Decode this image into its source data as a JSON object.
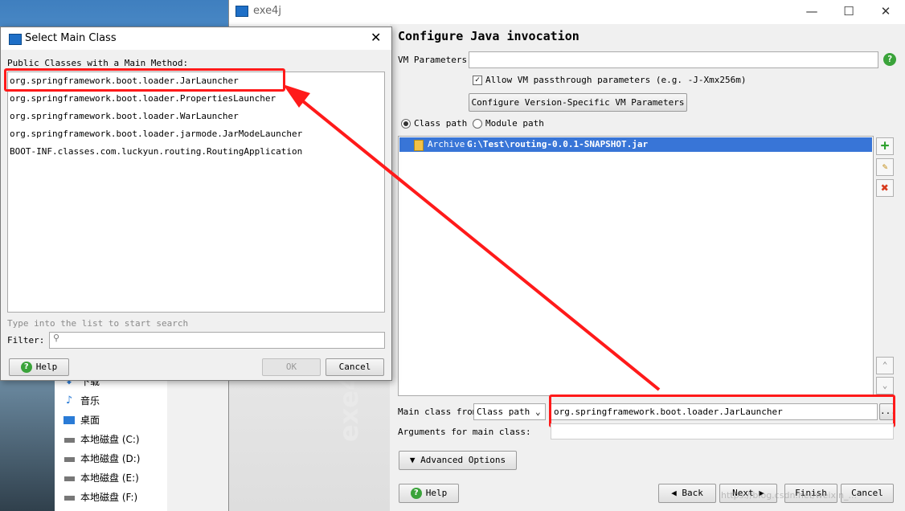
{
  "desktop": {
    "explorer_items": [
      {
        "label": "下载",
        "icon": "download-arrow-icon"
      },
      {
        "label": "音乐",
        "icon": "music-note-icon"
      },
      {
        "label": "桌面",
        "icon": "desktop-icon"
      },
      {
        "label": "本地磁盘 (C:)",
        "icon": "drive-icon"
      },
      {
        "label": "本地磁盘 (D:)",
        "icon": "drive-icon"
      },
      {
        "label": "本地磁盘 (E:)",
        "icon": "drive-icon"
      },
      {
        "label": "本地磁盘 (F:)",
        "icon": "drive-icon"
      }
    ]
  },
  "main_window": {
    "title": "exe4j",
    "controls": {
      "minimize": "—",
      "maximize": "☐",
      "close": "✕"
    },
    "sidebar_logo": "exe4j",
    "heading": "Configure Java invocation",
    "vm_parameters": {
      "label": "VM Parameters:",
      "value": ""
    },
    "allow_passthrough": {
      "label": "Allow VM passthrough parameters (e.g. -J-Xmx256m)",
      "checked": true
    },
    "version_specific_button": "Configure Version-Specific VM Parameters",
    "path_options": [
      {
        "label": "Class path",
        "selected": true
      },
      {
        "label": "Module path",
        "selected": false
      }
    ],
    "classpath_entry": {
      "type": "Archive",
      "path": "G:\\Test\\routing-0.0.1-SNAPSHOT.jar"
    },
    "main_class": {
      "label": "Main class from",
      "source": "Class path",
      "value": "org.springframework.boot.loader.JarLauncher",
      "browse": "..."
    },
    "arguments": {
      "label": "Arguments for main class:",
      "value": ""
    },
    "advanced_options": "Advanced Options",
    "footer": {
      "help": "Help",
      "back": "Back",
      "next": "Next",
      "finish": "Finish",
      "cancel": "Cancel"
    },
    "watermark": "https://blog.csdn.net/weixin_..."
  },
  "dialog": {
    "title": "Select Main Class",
    "list_label": "Public Classes with a Main Method:",
    "classes": [
      "org.springframework.boot.loader.JarLauncher",
      "org.springframework.boot.loader.PropertiesLauncher",
      "org.springframework.boot.loader.WarLauncher",
      "org.springframework.boot.loader.jarmode.JarModeLauncher",
      "BOOT-INF.classes.com.luckyun.routing.RoutingApplication"
    ],
    "hint": "Type into the list to start search",
    "filter_label": "Filter:",
    "filter_value": "",
    "help": "Help",
    "ok": "OK",
    "cancel": "Cancel"
  },
  "colors": {
    "selection": "#3875d7",
    "annotation": "#ff1a1a",
    "help_green": "#3aa33a"
  }
}
